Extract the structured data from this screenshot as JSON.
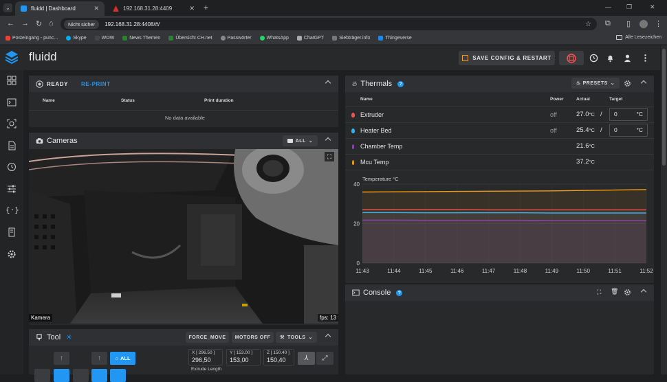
{
  "browser": {
    "tabs": [
      {
        "title": "fluidd | Dashboard"
      },
      {
        "title": "192.168.31.28:4409"
      }
    ],
    "not_secure": "Nicht sicher",
    "url": "192.168.31.28:4408/#/",
    "bookmarks": [
      {
        "label": "Posteingang - punc...",
        "color": "#ea4335"
      },
      {
        "label": "Skype",
        "color": "#00aff0"
      },
      {
        "label": "WOW",
        "color": "#444"
      },
      {
        "label": "News Themen",
        "color": "#2e7d32"
      },
      {
        "label": "Übersicht CH.net",
        "color": "#2e7d32"
      },
      {
        "label": "Passwörter",
        "color": "#888"
      },
      {
        "label": "WhatsApp",
        "color": "#25d366"
      },
      {
        "label": "ChatGPT",
        "color": "#aaa"
      },
      {
        "label": "Siebträger.info",
        "color": "#777"
      },
      {
        "label": "Thingeverse",
        "color": "#1e88e5"
      }
    ],
    "all_bookmarks": "Alle Lesezeichen"
  },
  "app": {
    "brand": "fluidd",
    "save_config": "SAVE CONFIG & RESTART",
    "accent": "#2196f3"
  },
  "status_card": {
    "state": "READY",
    "reprint": "RE-PRINT",
    "columns": [
      "Name",
      "Status",
      "Print duration"
    ],
    "empty": "No data available"
  },
  "cameras": {
    "title": "Cameras",
    "filter": "ALL",
    "label": "Kamera",
    "fps": "fps: 13"
  },
  "tool": {
    "title": "Tool",
    "force_move": "FORCE_MOVE",
    "motors_off": "MOTORS OFF",
    "tools": "TOOLS",
    "all": "ALL",
    "x_label": "X [ 296.50 ]",
    "x_value": "296,50",
    "y_label": "Y [ 153.00 ]",
    "y_value": "153,00",
    "z_label": "Z [ 150.40 ]",
    "z_value": "150,40",
    "extrude_label": "Extrude Length"
  },
  "thermals": {
    "title": "Thermals",
    "presets": "PRESETS",
    "columns": [
      "Name",
      "Power",
      "Actual",
      "Target"
    ],
    "rows": [
      {
        "name": "Extruder",
        "power": "off",
        "actual": "27.0",
        "unit": "°C",
        "slash": "/",
        "target": "0",
        "target_unit": "°C",
        "color": "#ef5350"
      },
      {
        "name": "Heater Bed",
        "power": "off",
        "actual": "25.4",
        "unit": "°C",
        "slash": "/",
        "target": "0",
        "target_unit": "°C",
        "color": "#29b6f6"
      },
      {
        "name": "Chamber Temp",
        "power": "",
        "actual": "21.6",
        "unit": "°C",
        "color": "#8e44ad"
      },
      {
        "name": "Mcu Temp",
        "power": "",
        "actual": "37.2",
        "unit": "°C",
        "color": "#f39c12"
      }
    ]
  },
  "chart_data": {
    "type": "line",
    "title": "",
    "ylabel": "Temperature °C",
    "xlabel": "",
    "ylim": [
      0,
      40
    ],
    "yticks": [
      0,
      20,
      40
    ],
    "x": [
      "11:43",
      "11:44",
      "11:45",
      "11:46",
      "11:47",
      "11:48",
      "11:49",
      "11:50",
      "11:51",
      "11:52"
    ],
    "grid": true,
    "series": [
      {
        "name": "Mcu Temp",
        "color": "#f39c12",
        "values": [
          36.0,
          36.1,
          36.2,
          36.3,
          36.4,
          36.5,
          36.6,
          36.8,
          37.0,
          37.2
        ]
      },
      {
        "name": "Extruder",
        "color": "#ef5350",
        "values": [
          27.1,
          27.1,
          27.1,
          27.1,
          27.0,
          27.0,
          27.0,
          27.0,
          27.0,
          27.0
        ]
      },
      {
        "name": "Heater Bed",
        "color": "#29b6f6",
        "values": [
          25.6,
          25.6,
          25.5,
          25.5,
          25.5,
          25.5,
          25.4,
          25.4,
          25.4,
          25.4
        ]
      },
      {
        "name": "Chamber Temp",
        "color": "#8e44ad",
        "values": [
          21.8,
          21.8,
          21.7,
          21.7,
          21.7,
          21.7,
          21.6,
          21.6,
          21.6,
          21.6
        ]
      }
    ]
  },
  "console": {
    "title": "Console"
  }
}
